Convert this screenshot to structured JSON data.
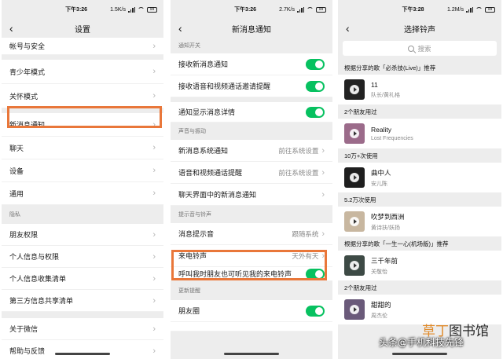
{
  "panels": [
    {
      "time": "下午3:26",
      "speed": "1.5K/s",
      "battery": "99",
      "title": "设置",
      "top_row": "帐号与安全",
      "rows": [
        "青少年模式",
        "关怀模式",
        "新消息通知",
        "聊天",
        "设备",
        "通用"
      ],
      "privacy_section": "隐私",
      "privacy_rows": [
        "朋友权限",
        "个人信息与权限",
        "个人信息收集清单",
        "第三方信息共享清单"
      ],
      "bottom_rows": [
        "关于微信",
        "帮助与反馈"
      ]
    },
    {
      "time": "下午3:26",
      "speed": "2.7K/s",
      "battery": "99",
      "title": "新消息通知",
      "section_switch": "通知开关",
      "switch_rows": [
        "接收新消息通知",
        "接收语音和视频通话邀请提醒",
        "通知显示消息详情"
      ],
      "section_sound": "声音与振动",
      "sound_rows": [
        {
          "label": "新消息系统通知",
          "value": "前往系统设置"
        },
        {
          "label": "语音和视频通话提醒",
          "value": "前往系统设置"
        },
        {
          "label": "聊天界面中的新消息通知",
          "value": ""
        }
      ],
      "section_tone": "提示音与铃声",
      "tone_rows": [
        {
          "label": "消息提示音",
          "value": "跟随系统"
        },
        {
          "label": "来电铃声",
          "value": "天外有天"
        }
      ],
      "ringtone_hint": "呼叫我时朋友也可听见我的来电铃声",
      "section_update": "更新提醒",
      "update_rows": [
        "朋友圈"
      ]
    },
    {
      "time": "下午3:28",
      "speed": "1.2M/s",
      "battery": "99",
      "title": "选择铃声",
      "search_placeholder": "搜索",
      "groups": [
        {
          "heading": "根据分享的歌「必杀技(Live)」推荐",
          "song": "11",
          "artist": "队长/黄礼格",
          "cover": "#222222"
        },
        {
          "heading": "2个朋友用过",
          "song": "Reality",
          "artist": "Lost Frequencies",
          "cover": "#9b6b8a"
        },
        {
          "heading": "10万+次使用",
          "song": "曲中人",
          "artist": "安儿陈",
          "cover": "#1e1e1e"
        },
        {
          "heading": "5.2万次使用",
          "song": "吹梦到西洲",
          "artist": "黄诗扶/妖扬",
          "cover": "#c8b7a0"
        },
        {
          "heading": "根据分享的歌「一生一心(机场版)」推荐",
          "song": "三千年前",
          "artist": "关敬怡",
          "cover": "#3d4a45"
        },
        {
          "heading": "2个朋友用过",
          "song": "甜甜的",
          "artist": "周杰伦",
          "cover": "#6a5a7a"
        }
      ]
    }
  ],
  "watermarks": {
    "brand_a": "草丁",
    "brand_b": "图书馆",
    "channel": "头条@手机科技先锋"
  },
  "colors": {
    "accent_green": "#07c160",
    "highlight_orange": "#e9773a"
  }
}
